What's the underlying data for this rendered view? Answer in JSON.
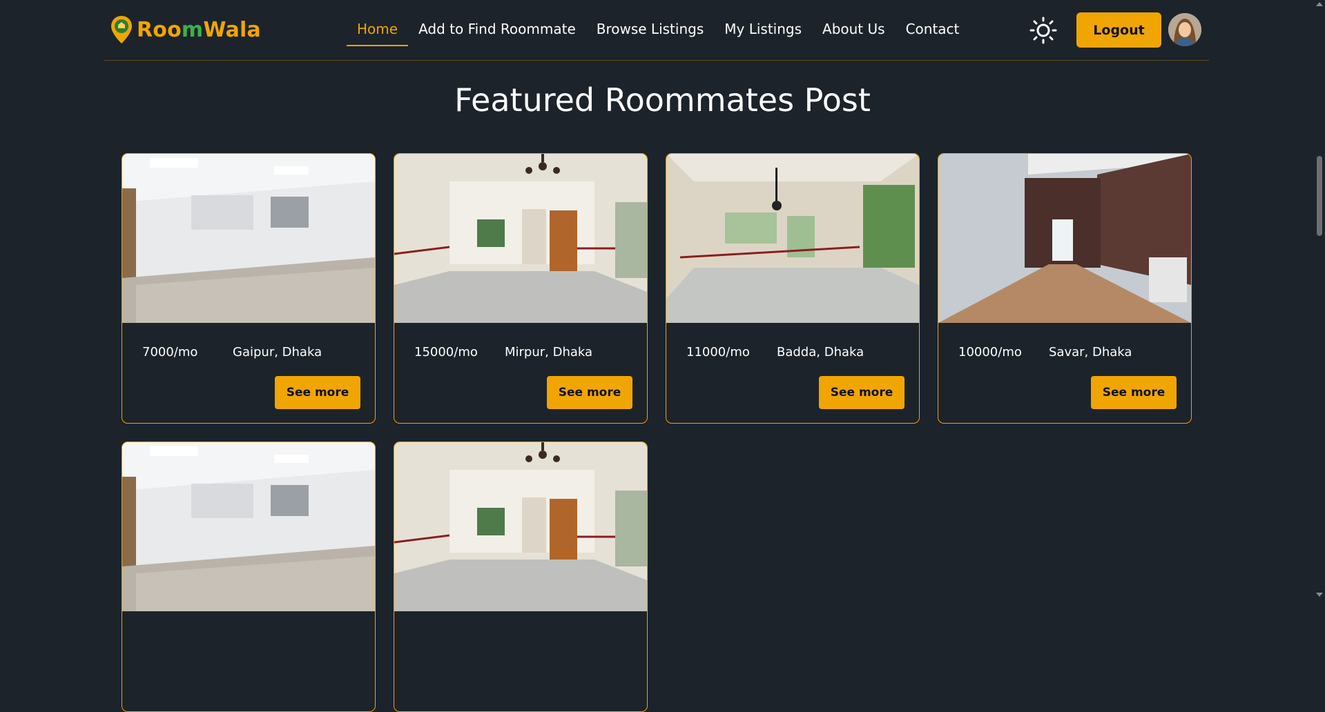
{
  "brand": {
    "part1": "Roo",
    "part2": "m",
    "part3": "Wala"
  },
  "nav": {
    "items": [
      {
        "label": "Home",
        "active": true
      },
      {
        "label": "Add to Find Roommate",
        "active": false
      },
      {
        "label": "Browse Listings",
        "active": false
      },
      {
        "label": "My Listings",
        "active": false
      },
      {
        "label": "About Us",
        "active": false
      },
      {
        "label": "Contact",
        "active": false
      }
    ],
    "theme_icon": "sun-icon",
    "logout_label": "Logout"
  },
  "section": {
    "title": "Featured Roommates Post"
  },
  "cards": [
    {
      "rent": "7000/mo",
      "location": "Gaipur, Dhaka",
      "button": "See more",
      "image": "room-office-white"
    },
    {
      "rent": "15000/mo",
      "location": "Mirpur, Dhaka",
      "button": "See more",
      "image": "room-chandelier-door"
    },
    {
      "rent": "11000/mo",
      "location": "Badda, Dhaka",
      "button": "See more",
      "image": "room-chandelier-windows"
    },
    {
      "rent": "10000/mo",
      "location": "Savar, Dhaka",
      "button": "See more",
      "image": "room-long-wood-floor"
    },
    {
      "rent": "",
      "location": "",
      "button": "",
      "image": "room-office-white"
    },
    {
      "rent": "",
      "location": "",
      "button": "",
      "image": "room-chandelier-door"
    }
  ],
  "colors": {
    "accent": "#f0a500",
    "green": "#37b34a",
    "background": "#1d232a"
  }
}
